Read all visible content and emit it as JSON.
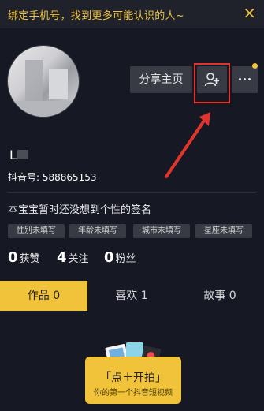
{
  "banner": {
    "text": "绑定手机号，找到更多可能认识的人~",
    "close": "×"
  },
  "profile": {
    "share_label": "分享主页",
    "nickname": "L",
    "douyin_id": "抖音号: 588865153",
    "signature": "本宝宝暂时还没想到个性的签名"
  },
  "tags": [
    "性别未填写",
    "年龄未填写",
    "城市未填写",
    "星座未填写"
  ],
  "stats": [
    {
      "num": "0",
      "label": "获赞"
    },
    {
      "num": "4",
      "label": "关注"
    },
    {
      "num": "0",
      "label": "粉丝"
    }
  ],
  "tabs": [
    {
      "label": "作品 0",
      "active": true
    },
    {
      "label": "喜欢 1",
      "active": false
    },
    {
      "label": "故事 0",
      "active": false
    }
  ],
  "empty_state": {
    "title": "「点＋开拍」",
    "subtitle": "你的第一个抖音短视频"
  },
  "colors": {
    "accent": "#f1c33a",
    "background": "#161823",
    "highlight": "#e1342d"
  },
  "icons": {
    "add_friend": "add-friend-icon",
    "more": "more-icon",
    "annotation": "arrow-annotation"
  }
}
